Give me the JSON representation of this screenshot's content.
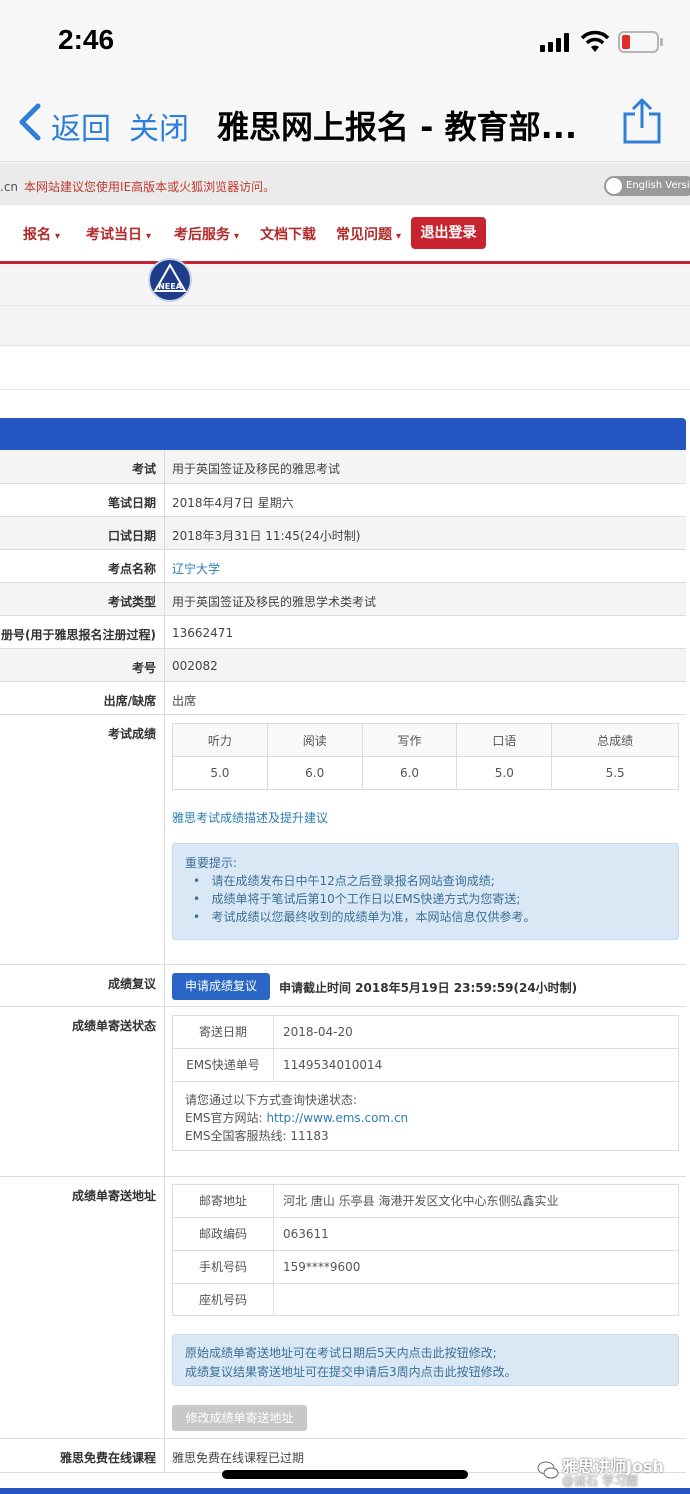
{
  "status_bar": {
    "time": "2:46",
    "icons": [
      "cellular-signal-icon",
      "wifi-icon",
      "battery-low-icon"
    ]
  },
  "nav": {
    "back_label": "返回",
    "close_label": "关闭",
    "title": "雅思网上报名 - 教育部...",
    "icons": [
      "back-chevron-icon",
      "share-icon"
    ]
  },
  "notice": {
    "domain_fragment": ".cn",
    "text": "本网站建议您使用IE高版本或火狐浏览器访问。",
    "english_toggle": "English Version"
  },
  "menu": {
    "items": [
      {
        "label": "报名",
        "caret": "▾"
      },
      {
        "label": "考试当日",
        "caret": "▾"
      },
      {
        "label": "考后服务",
        "caret": "▾"
      },
      {
        "label": "文档下载",
        "caret": ""
      },
      {
        "label": "常见问题",
        "caret": "▾"
      }
    ],
    "logout": "退出登录",
    "logo_text": "NEEA"
  },
  "info": {
    "exam": {
      "label": "考试",
      "value": "用于英国签证及移民的雅思考试"
    },
    "written_date": {
      "label": "笔试日期",
      "value": "2018年4月7日 星期六"
    },
    "speaking_date": {
      "label": "口试日期",
      "value": "2018年3月31日 11:45(24小时制)"
    },
    "center": {
      "label": "考点名称",
      "value": "辽宁大学"
    },
    "exam_type": {
      "label": "考试类型",
      "value": "用于英国签证及移民的雅思学术类考试"
    },
    "reg_no": {
      "label": "册号(用于雅思报名注册过程)",
      "value": "13662471"
    },
    "candidate_no": {
      "label": "考号",
      "value": "002082"
    },
    "attendance": {
      "label": "出席/缺席",
      "value": "出席"
    },
    "scores_label": "考试成绩"
  },
  "scores": {
    "headers": [
      "听力",
      "阅读",
      "写作",
      "口语",
      "总成绩"
    ],
    "values": [
      "5.0",
      "6.0",
      "6.0",
      "5.0",
      "5.5"
    ],
    "advice_link": "雅思考试成绩描述及提升建议"
  },
  "tips": {
    "title": "重要提示:",
    "items": [
      "请在成绩发布日中午12点之后登录报名网站查询成绩;",
      "成绩单将于笔试后第10个工作日以EMS快递方式为您寄送;",
      "考试成绩以您最终收到的成绩单为准，本网站信息仅供参考。"
    ]
  },
  "review": {
    "label": "成绩复议",
    "button": "申请成绩复议",
    "deadline": "申请截止时间 2018年5月19日 23:59:59(24小时制)"
  },
  "delivery": {
    "label": "成绩单寄送状态",
    "send_date_label": "寄送日期",
    "send_date": "2018-04-20",
    "ems_label": "EMS快递单号",
    "ems_no": "1149534010014",
    "query_intro": "请您通过以下方式查询快递状态:",
    "ems_site_label": "EMS官方网站:",
    "ems_site": "http://www.ems.com.cn",
    "ems_hotline": "EMS全国客服热线: 11183"
  },
  "address": {
    "label": "成绩单寄送地址",
    "mail_addr_label": "邮寄地址",
    "mail_addr": "河北 唐山 乐亭县 海港开发区文化中心东侧弘鑫实业",
    "postcode_label": "邮政编码",
    "postcode": "063611",
    "mobile_label": "手机号码",
    "mobile": "159****9600",
    "landline_label": "座机号码",
    "landline": "",
    "note_1": "原始成绩单寄送地址可在考试日期后5天内点击此按钮修改;",
    "note_2": "成绩复议结果寄送地址可在提交申请后3周内点击此按钮修改。",
    "modify_button": "修改成绩单寄送地址"
  },
  "online_course": {
    "label": "雅思免费在线课程",
    "value": "雅思免费在线课程已过期"
  },
  "watermark": {
    "text": "雅思讲师Josh",
    "sub": "@谜石 学习圈"
  }
}
